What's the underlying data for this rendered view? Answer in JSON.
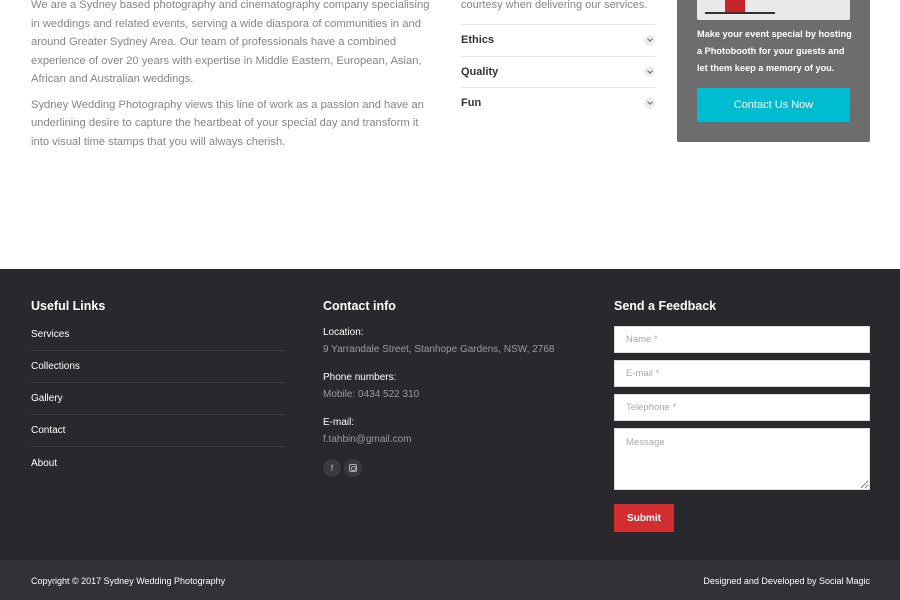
{
  "about": {
    "paragraphs": [
      "We are a Sydney based photography and cinematography company specialising in weddings and related events, serving a wide diaspora of communities in and around Greater Sydney Area. Our team of professionals have  a combined experience of over 20 years with expertise in Middle Eastern, European, Asian, African and Australian weddings.",
      "Sydney Wedding Photography views this line of work as a passion and have an underlining desire to capture the heartbeat of your special day and transform it into visual time stamps that you will always cherish."
    ]
  },
  "accordion": {
    "intro": "courtesy when delivering our services.",
    "items": [
      {
        "label": "Ethics"
      },
      {
        "label": "Quality"
      },
      {
        "label": "Fun"
      }
    ]
  },
  "promo": {
    "text": "Make your event special by hosting a Photobooth for your guests and let them keep a memory of you.",
    "button": "Contact Us Now",
    "button_color": "#00bcd0",
    "background": "#6d6d6d"
  },
  "footer": {
    "links_title": "Useful Links",
    "links": [
      "Services",
      "Collections",
      "Gallery",
      "Contact",
      "About"
    ],
    "contact_title": "Contact info",
    "location_label": "Location:",
    "location_value": "9 Yarrandale Street, Stanhope Gardens, NSW, 2768",
    "phone_label": "Phone numbers:",
    "phone_value": "Mobile: 0434 522 310",
    "email_label": "E-mail:",
    "email_value": "f.tahbin@gmail.com",
    "socials": [
      "facebook-icon",
      "instagram-icon"
    ],
    "feedback_title": "Send a Feedback",
    "form": {
      "name_placeholder": "Name *",
      "email_placeholder": "E-mail *",
      "phone_placeholder": "Telephone *",
      "message_placeholder": "Message",
      "submit": "Submit",
      "submit_color": "#d22e2f"
    }
  },
  "bottom_bar": {
    "copyright": "Copyright © 2017 Sydney Wedding Photography",
    "credit": "Designed and Developed by Social Magic"
  }
}
